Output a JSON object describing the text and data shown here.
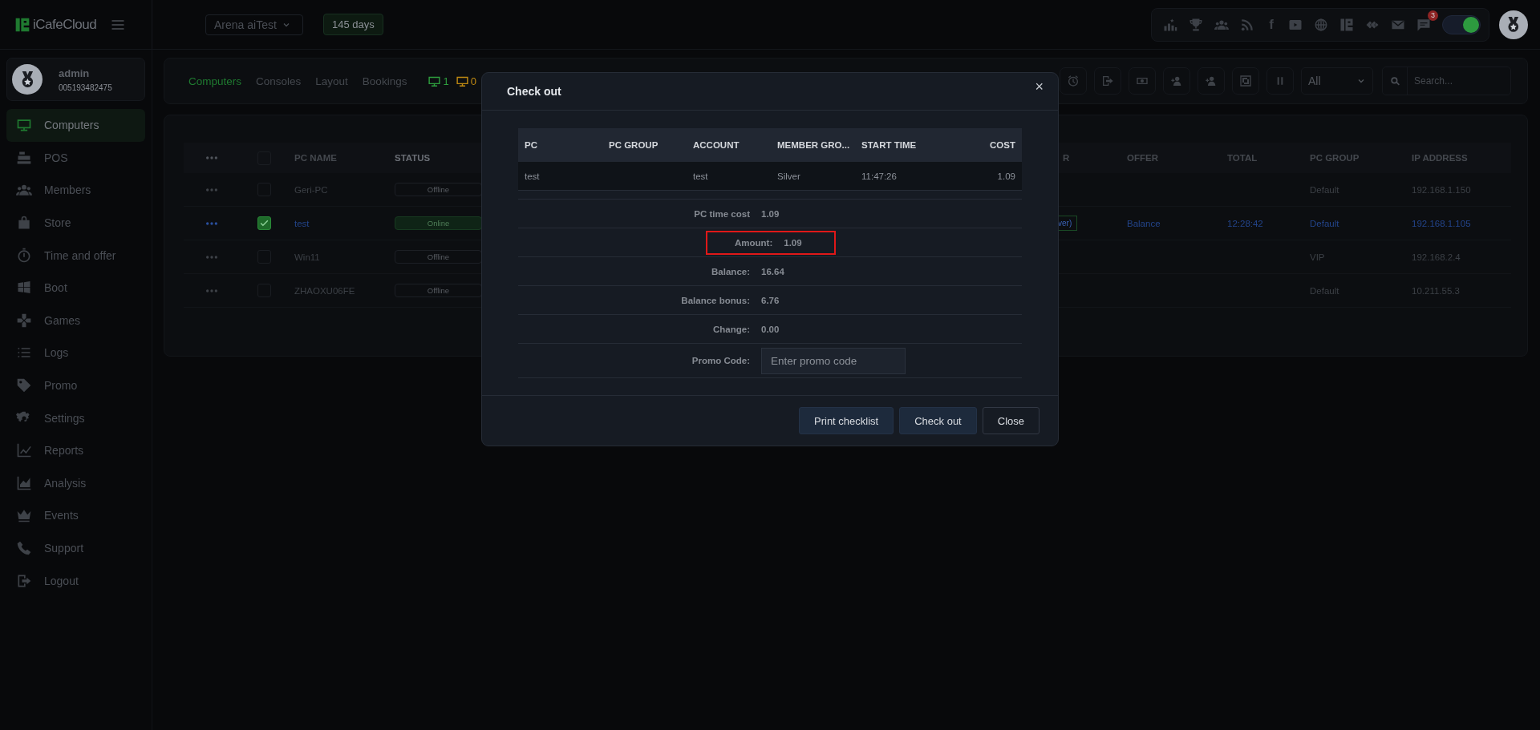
{
  "topbar": {
    "logo": "iCafeCloud",
    "cafe_select": "Arena aiTest",
    "license_badge": "145 days",
    "notification_count": "3",
    "facebook_label": "f",
    "toggle_on": true
  },
  "user": {
    "name": "admin",
    "id": "005193482475"
  },
  "sidebar": {
    "items": [
      {
        "label": "Computers",
        "selected": true
      },
      {
        "label": "POS",
        "selected": false
      },
      {
        "label": "Members",
        "selected": false
      },
      {
        "label": "Store",
        "selected": false
      },
      {
        "label": "Time and offer",
        "selected": false
      },
      {
        "label": "Boot",
        "selected": false
      },
      {
        "label": "Games",
        "selected": false
      },
      {
        "label": "Logs",
        "selected": false
      },
      {
        "label": "Promo",
        "selected": false
      },
      {
        "label": "Settings",
        "selected": false
      },
      {
        "label": "Reports",
        "selected": false
      },
      {
        "label": "Analysis",
        "selected": false
      },
      {
        "label": "Events",
        "selected": false
      },
      {
        "label": "Support",
        "selected": false
      },
      {
        "label": "Logout",
        "selected": false
      }
    ]
  },
  "toolbar": {
    "tabs": [
      {
        "label": "Computers",
        "selected": true
      },
      {
        "label": "Consoles",
        "selected": false
      },
      {
        "label": "Layout",
        "selected": false
      },
      {
        "label": "Bookings",
        "selected": false
      }
    ],
    "counters": [
      {
        "value": "1",
        "color": "#2e9e3e"
      },
      {
        "value": "0",
        "color": "#c08a12"
      }
    ],
    "filter": "All",
    "search_placeholder": "Search..."
  },
  "table": {
    "select_all_checked": false,
    "columns": [
      "PC NAME",
      "STATUS",
      "R",
      "OFFER",
      "TOTAL",
      "PC GROUP",
      "IP ADDRESS"
    ],
    "rows": [
      {
        "pc_name": "Geri-PC",
        "status": "Offline",
        "online": false,
        "tag": "",
        "offer": "",
        "total": "",
        "pc_group": "Default",
        "ip": "192.168.1.150",
        "selected": false
      },
      {
        "pc_name": "test",
        "status": "Online",
        "online": true,
        "tag": "ver)",
        "offer": "Balance",
        "total": "12:28:42",
        "pc_group": "Default",
        "ip": "192.168.1.105",
        "selected": true
      },
      {
        "pc_name": "Win11",
        "status": "Offline",
        "online": false,
        "tag": "",
        "offer": "",
        "total": "",
        "pc_group": "VIP",
        "ip": "192.168.2.4",
        "selected": false
      },
      {
        "pc_name": "ZHAOXU06FE",
        "status": "Offline",
        "online": false,
        "tag": "",
        "offer": "",
        "total": "",
        "pc_group": "Default",
        "ip": "10.211.55.3",
        "selected": false
      }
    ]
  },
  "dialog": {
    "title": "Check out",
    "close": "×",
    "table": {
      "columns": [
        "PC",
        "PC GROUP",
        "ACCOUNT",
        "MEMBER GRO...",
        "START TIME",
        "COST"
      ],
      "rows": [
        [
          "test",
          "",
          "test",
          "Silver",
          "11:47:26",
          "1.09"
        ]
      ]
    },
    "summary": [
      {
        "label": "PC time cost",
        "value": "1.09",
        "highlighted": false
      },
      {
        "label": "Amount:",
        "value": "1.09",
        "highlighted": true
      },
      {
        "label": "Balance:",
        "value": "16.64",
        "highlighted": false
      },
      {
        "label": "Balance bonus:",
        "value": "6.76",
        "highlighted": false
      },
      {
        "label": "Change:",
        "value": "0.00",
        "highlighted": false
      }
    ],
    "promo": {
      "label": "Promo Code:",
      "placeholder": "Enter promo code"
    },
    "buttons": [
      {
        "label": "Print checklist",
        "kind": "secondary"
      },
      {
        "label": "Check out",
        "kind": "primary"
      },
      {
        "label": "Close",
        "kind": "outline"
      }
    ]
  }
}
